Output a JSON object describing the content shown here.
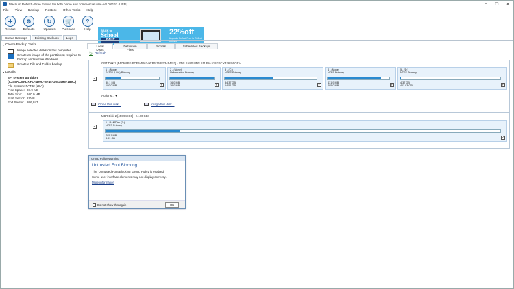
{
  "title": "Macrium Reflect - Free Edition for both home and commercial use - v8.0.6161 (UEFI)",
  "menu": [
    "File",
    "View",
    "Backup",
    "Restore",
    "Other Tasks",
    "Help"
  ],
  "toolbar": [
    {
      "label": "Rescue",
      "icon": "rescue-icon",
      "glyph": "✚"
    },
    {
      "label": "Defaults",
      "icon": "defaults-icon",
      "glyph": "⚙"
    },
    {
      "label": "Updates",
      "icon": "updates-icon",
      "glyph": "↻"
    },
    {
      "label": "Purchase",
      "icon": "purchase-icon",
      "glyph": "🛒"
    },
    {
      "label": "Help",
      "icon": "help-icon",
      "glyph": "?"
    }
  ],
  "banner": {
    "back": "BACK to",
    "school": "School",
    "sale": "SALE",
    "pct": "22%off",
    "note": "Upgrade Reflect Free to Reflect 8 today",
    "color": "#4bb7e8"
  },
  "main_tabs": [
    "Create Backups",
    "Existing Backups",
    "Logs"
  ],
  "left": {
    "tasks_header": "Create Backup Tasks",
    "tasks": [
      "Image selected disks on this computer",
      "Create an image of the partition(s) required to backup and restore Windows",
      "Create a File and Folder backup"
    ],
    "details_header": "Details",
    "part_name": "EFI system partition",
    "part_guid": "{C245AC59-DAFC-4D0C-B744-D5434967189C}",
    "fs": "File System: FAT32 (LBA)",
    "kv": [
      {
        "k": "Free Space:",
        "v": "69.9 MB"
      },
      {
        "k": "Total Size:",
        "v": "100.0 MB"
      },
      {
        "k": "Start Sector:",
        "v": "2,048"
      },
      {
        "k": "End Sector:",
        "v": "206,847"
      }
    ]
  },
  "disk_tabs": [
    "Local Disks",
    "Definition Files",
    "Scripts",
    "Scheduled Backups"
  ],
  "refresh": "Refresh",
  "disk1": {
    "header": "GPT Disk 1 [F47369BE-BCF3-4D63-9CB6-7588234F4311] - VDS SAMSUNG 511 Pro 512GBC  <476.94 GB>",
    "actions": "Actions...",
    "clone": "Clone this disk...",
    "image": "Image this disk...",
    "partitions": [
      {
        "title": "1 - (None)",
        "type": "FAT32 (LBA) Primary",
        "used": "30.1 MB",
        "total": "100.0 MB",
        "fill": 0.3
      },
      {
        "title": "2 - (None)",
        "type": "Unformatted Primary",
        "used": "16.0 MB",
        "total": "16.0 MB",
        "fill": 1.0
      },
      {
        "title": "3 - (C:)",
        "type": "NTFS Primary",
        "used": "34.37 GB",
        "total": "64.51 GB",
        "fill": 0.53
      },
      {
        "title": "4 - (None)",
        "type": "NTFS Primary",
        "used": "431.9 MB",
        "total": "495.0 MB",
        "fill": 0.87
      },
      {
        "title": "5 - (D:)",
        "type": "NTFS Primary",
        "used": "4.37 GB",
        "total": "411.83 GB",
        "fill": 0.01
      }
    ]
  },
  "disk2": {
    "header": "MBR Disk 2 [45C94EC0] - <4.00 GB>",
    "partitions": [
      {
        "title": "1 - RAMDisk (Z:)",
        "type": "NTFS Primary",
        "used": "785.1 MB",
        "total": "3.99 GB",
        "fill": 0.19
      }
    ]
  },
  "dialog": {
    "title": "Group Policy Warning",
    "heading": "Untrusted Font Blocking",
    "msg1": "The 'Untrusted Font Blocking' Group Policy is enabled.",
    "msg2": "Some user interface elements may not display correctly.",
    "link": "More information",
    "checkbox": "Do not show this again",
    "ok": "OK"
  }
}
